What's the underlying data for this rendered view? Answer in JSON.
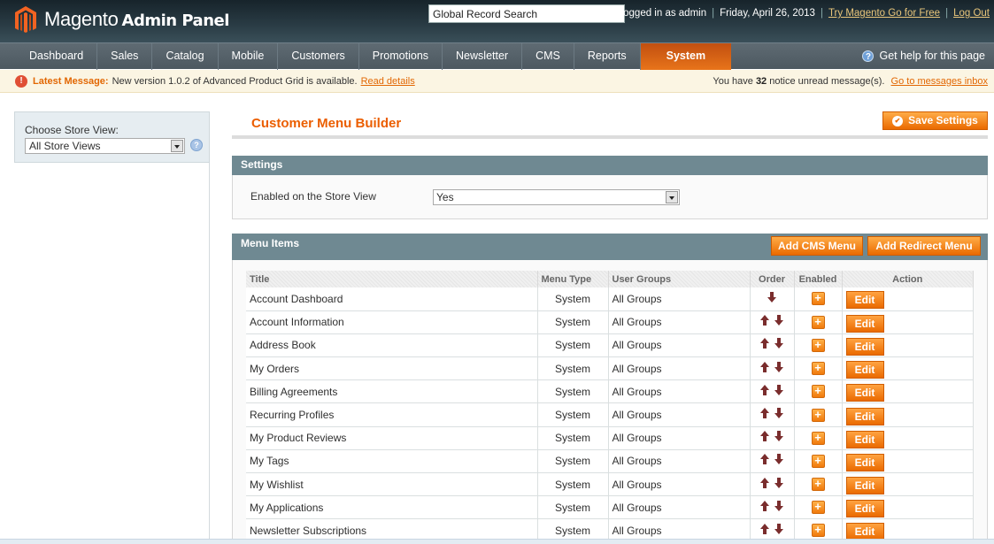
{
  "header": {
    "brand": "Magento",
    "brand_sub": "Admin Panel",
    "search_value": "Global Record Search",
    "logged_in": "Logged in as admin",
    "date": "Friday, April 26, 2013",
    "try_link": "Try Magento Go for Free",
    "logout": "Log Out"
  },
  "nav": {
    "items": [
      "Dashboard",
      "Sales",
      "Catalog",
      "Mobile",
      "Customers",
      "Promotions",
      "Newsletter",
      "CMS",
      "Reports",
      "System"
    ],
    "active": "System",
    "help": "Get help for this page"
  },
  "message": {
    "label": "Latest Message:",
    "text": "New version 1.0.2 of Advanced Product Grid is available.",
    "link": "Read details",
    "right_prefix": "You have",
    "count": "32",
    "right_suffix": "notice unread message(s).",
    "inbox_link": "Go to messages inbox"
  },
  "sidebar": {
    "store_label": "Choose Store View:",
    "store_value": "All Store Views"
  },
  "main": {
    "title": "Customer Menu Builder",
    "save_label": "Save Settings",
    "settings": {
      "heading": "Settings",
      "enabled_label": "Enabled on the Store View",
      "enabled_value": "Yes"
    },
    "menu": {
      "heading": "Menu Items",
      "add_cms": "Add CMS Menu",
      "add_redirect": "Add Redirect Menu",
      "columns": [
        "Title",
        "Menu Type",
        "User Groups",
        "Order",
        "Enabled",
        "Action"
      ],
      "edit_label": "Edit",
      "rows": [
        {
          "title": "Account Dashboard",
          "type": "System",
          "groups": "All Groups",
          "up": false,
          "down": true
        },
        {
          "title": "Account Information",
          "type": "System",
          "groups": "All Groups",
          "up": true,
          "down": true
        },
        {
          "title": "Address Book",
          "type": "System",
          "groups": "All Groups",
          "up": true,
          "down": true
        },
        {
          "title": "My Orders",
          "type": "System",
          "groups": "All Groups",
          "up": true,
          "down": true
        },
        {
          "title": "Billing Agreements",
          "type": "System",
          "groups": "All Groups",
          "up": true,
          "down": true
        },
        {
          "title": "Recurring Profiles",
          "type": "System",
          "groups": "All Groups",
          "up": true,
          "down": true
        },
        {
          "title": "My Product Reviews",
          "type": "System",
          "groups": "All Groups",
          "up": true,
          "down": true
        },
        {
          "title": "My Tags",
          "type": "System",
          "groups": "All Groups",
          "up": true,
          "down": true
        },
        {
          "title": "My Wishlist",
          "type": "System",
          "groups": "All Groups",
          "up": true,
          "down": true
        },
        {
          "title": "My Applications",
          "type": "System",
          "groups": "All Groups",
          "up": true,
          "down": true
        },
        {
          "title": "Newsletter Subscriptions",
          "type": "System",
          "groups": "All Groups",
          "up": true,
          "down": true
        }
      ]
    }
  },
  "colors": {
    "accent": "#eb5e00",
    "header_bg": "#1e2d35",
    "fieldset_head": "#6f8992",
    "arrow": "#7a2d2d"
  }
}
